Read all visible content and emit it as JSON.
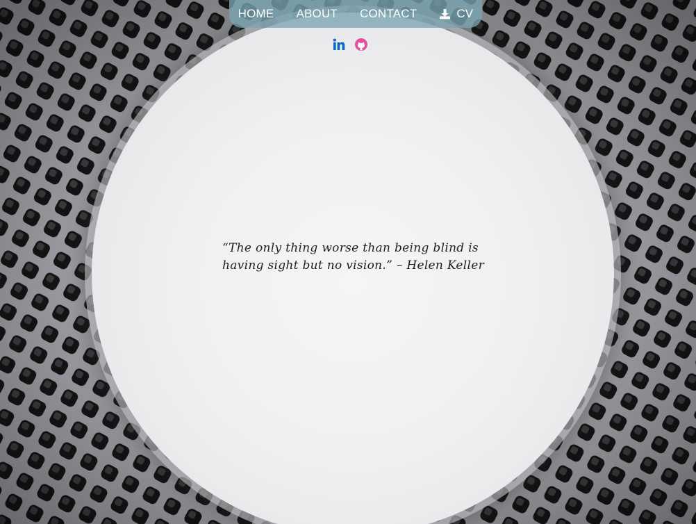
{
  "nav": {
    "items": [
      {
        "label": "HOME"
      },
      {
        "label": "ABOUT"
      },
      {
        "label": "CONTACT"
      },
      {
        "label": "CV",
        "icon": "download-icon"
      }
    ]
  },
  "social": {
    "linkedin": {
      "icon": "linkedin-icon",
      "color": "#0a66c2"
    },
    "github": {
      "icon": "github-icon",
      "color": "#e44fa0"
    }
  },
  "quote": {
    "text": "“The only thing worse than being blind is having sight but no vision.” – Helen Keller"
  }
}
